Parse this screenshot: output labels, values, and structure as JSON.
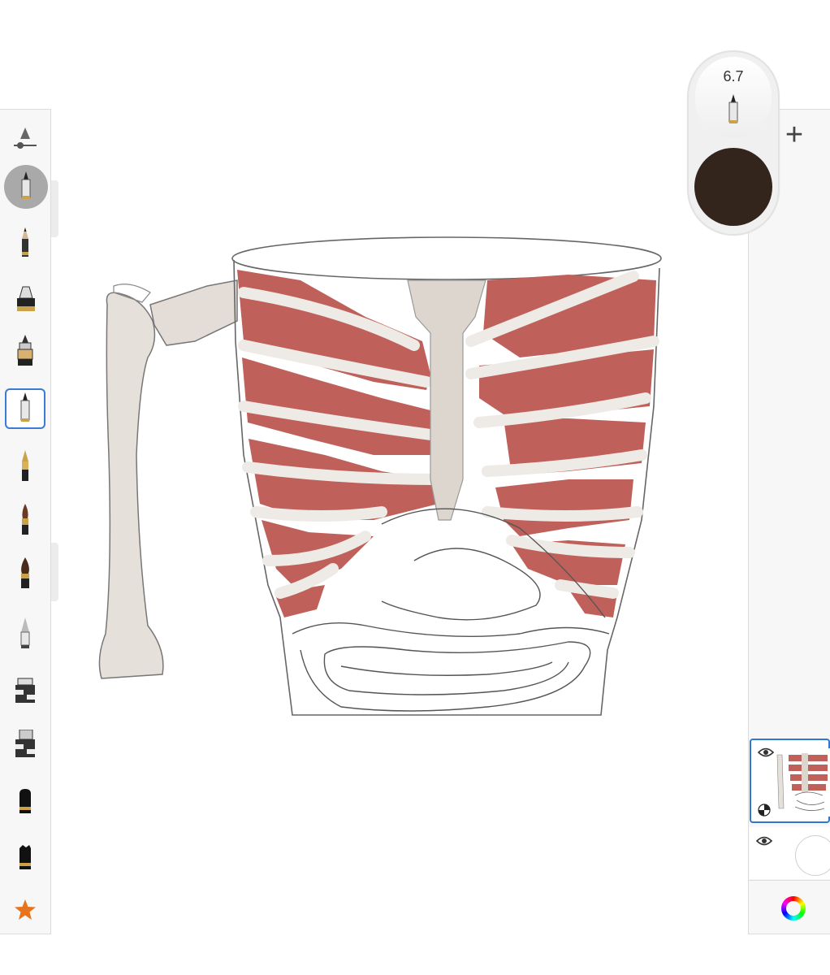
{
  "brush_puck": {
    "size_value": "6.7",
    "color": "#33241c"
  },
  "tool_panel": {
    "tools": [
      {
        "id": "brush-settings",
        "icon": "brush-settings-icon"
      },
      {
        "id": "current-brush",
        "icon": "ballpoint-pen-icon",
        "state": "current"
      },
      {
        "id": "pencil",
        "icon": "pencil-icon"
      },
      {
        "id": "marker",
        "icon": "marker-icon"
      },
      {
        "id": "fineliner",
        "icon": "fineliner-icon"
      },
      {
        "id": "ballpoint",
        "icon": "ballpoint-pen-icon",
        "state": "selected"
      },
      {
        "id": "fountain-pen",
        "icon": "fountain-pen-icon"
      },
      {
        "id": "paint-brush",
        "icon": "paint-brush-icon"
      },
      {
        "id": "ink-brush",
        "icon": "ink-brush-icon"
      },
      {
        "id": "airbrush",
        "icon": "airbrush-icon"
      },
      {
        "id": "chisel-marker",
        "icon": "chisel-marker-icon"
      },
      {
        "id": "wide-marker",
        "icon": "wide-marker-icon"
      },
      {
        "id": "hard-eraser",
        "icon": "hard-eraser-icon"
      },
      {
        "id": "soft-eraser",
        "icon": "soft-eraser-icon"
      },
      {
        "id": "favorites",
        "icon": "star-icon"
      }
    ]
  },
  "layers": {
    "add_label": "+",
    "items": [
      {
        "id": "drawing-layer",
        "visible": true,
        "active": true
      },
      {
        "id": "background-layer",
        "visible": true,
        "active": false
      }
    ]
  },
  "colors": {
    "muscle": "#c0605a",
    "bone": "#e8e2dc",
    "accent": "#2f78d1",
    "panel": "#f7f7f7"
  }
}
